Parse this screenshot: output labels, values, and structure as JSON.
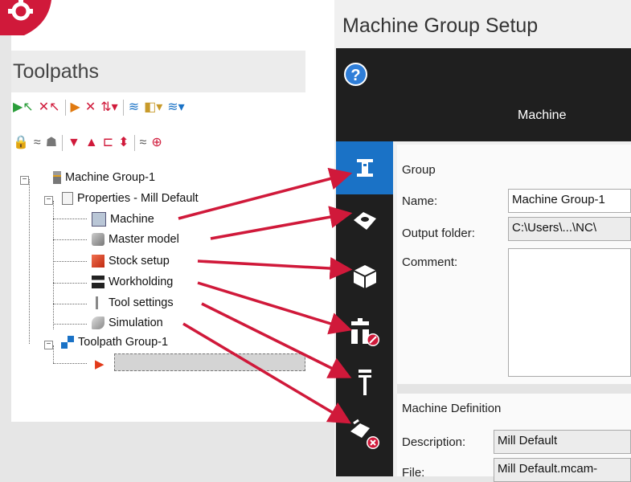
{
  "left_panel": {
    "title": "Toolpaths",
    "tree": {
      "machine_group": "Machine Group-1",
      "properties": "Properties - Mill Default",
      "machine": "Machine",
      "master_model": "Master model",
      "stock_setup": "Stock setup",
      "workholding": "Workholding",
      "tool_settings": "Tool settings",
      "simulation": "Simulation",
      "toolpath_group": "Toolpath Group-1"
    }
  },
  "right_panel": {
    "title": "Machine Group Setup",
    "help_glyph": "?",
    "tab_label": "Machine",
    "group": {
      "heading": "Group",
      "name_label": "Name:",
      "name_value": "Machine Group-1",
      "output_folder_label": "Output folder:",
      "output_folder_value": "C:\\Users\\...\\NC\\",
      "comment_label": "Comment:",
      "comment_value": ""
    },
    "machine_definition": {
      "heading": "Machine Definition",
      "description_label": "Description:",
      "description_value": "Mill Default",
      "file_label": "File:",
      "file_value": "Mill Default.mcam-"
    }
  },
  "colors": {
    "accent_red": "#d0193a",
    "rail_dark": "#1f1f1f",
    "rail_active": "#1a72c6"
  }
}
